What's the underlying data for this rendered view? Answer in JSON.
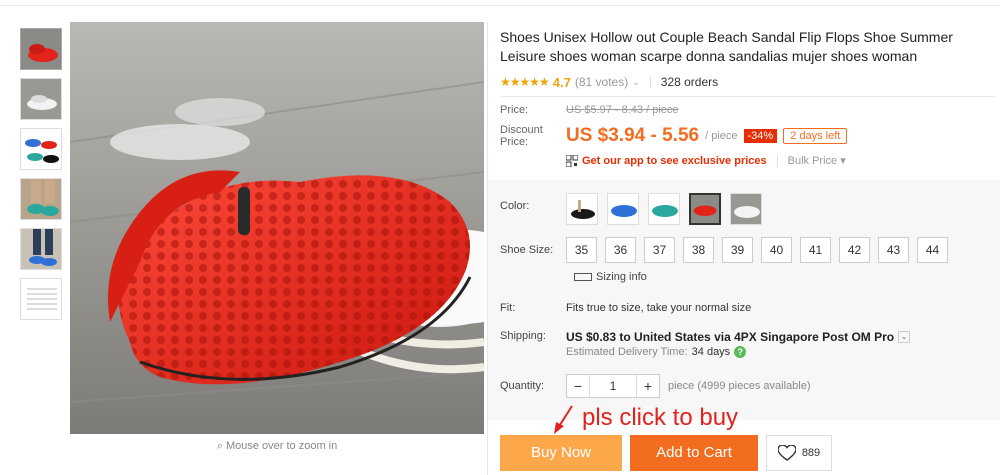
{
  "product": {
    "title": "Shoes Unisex Hollow out Couple Beach Sandal Flip Flops Shoe Summer Leisure shoes woman scarpe donna sandalias mujer shoes woman",
    "rating": {
      "stars": "★★★★★",
      "value": "4.7",
      "votes": "(81 votes)",
      "orders": "328 orders"
    }
  },
  "price": {
    "price_label": "Price:",
    "original": "US $5.97 - 8.43 / piece",
    "discount_label": "Discount Price:",
    "discount": "US $3.94 - 5.56",
    "per_piece": "/ piece",
    "discount_pct": "-34%",
    "days_left": "2 days left",
    "app_promo": "Get our app to see exclusive prices",
    "bulk_price": "Bulk Price"
  },
  "options": {
    "color_label": "Color:",
    "colors": [
      "black",
      "blue",
      "teal",
      "red",
      "white"
    ],
    "selected_color": "red",
    "size_label": "Shoe Size:",
    "sizes": [
      "35",
      "36",
      "37",
      "38",
      "39",
      "40",
      "41",
      "42",
      "43",
      "44"
    ],
    "sizing_info": "Sizing info",
    "fit_label": "Fit:",
    "fit_text": "Fits true to size, take your normal size",
    "shipping_label": "Shipping:",
    "shipping_price": "US $0.83",
    "shipping_to": "to United States via 4PX Singapore Post OM Pro",
    "delivery_label": "Estimated Delivery Time:",
    "delivery_value": "34 days",
    "quantity_label": "Quantity:",
    "quantity_minus": "−",
    "quantity_value": "1",
    "quantity_plus": "+",
    "availability": "piece (4999 pieces available)"
  },
  "gallery": {
    "zoom_hint": "Mouse over to zoom in"
  },
  "actions": {
    "buy_now": "Buy Now",
    "add_to_cart": "Add to Cart",
    "wishlist_count": "889"
  },
  "annotation": {
    "text": "pls click to buy"
  },
  "colors": {
    "accent": "#f36d21",
    "buy_now": "#fda74b",
    "badge": "#e62e04",
    "stars": "#f0a30a",
    "annotation": "#e0231f"
  }
}
